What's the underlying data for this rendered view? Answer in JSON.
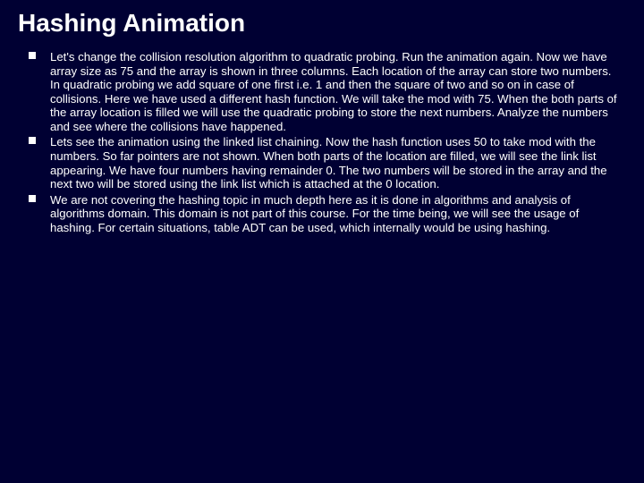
{
  "slide": {
    "title": "Hashing Animation",
    "bullets": [
      "Let's change the collision resolution algorithm to quadratic probing. Run the animation again. Now we have array size as 75 and the array is shown in three columns. Each location of the array can store two numbers. In quadratic probing we add square of one first i.e. 1 and then the square of two and so on in case of collisions. Here we have used a different hash function. We will take the mod with 75. When the both parts of the array location is filled we will use the quadratic probing to store the next numbers. Analyze the numbers and see where the collisions have happened.",
      "Lets see the animation using the linked list chaining. Now the hash function uses 50 to take mod with the numbers. So far pointers are not shown. When both parts of the location are filled, we will see the link list appearing. We have four numbers having remainder 0. The two numbers will be stored in the array and the next two will be stored using the link list which is attached at the 0 location.",
      "We are not covering the hashing topic in much depth here as it is done in algorithms and analysis of algorithms domain. This domain is not part of this course. For the time being, we will see the usage of hashing. For certain situations, table ADT can be used, which internally would be using hashing."
    ]
  }
}
